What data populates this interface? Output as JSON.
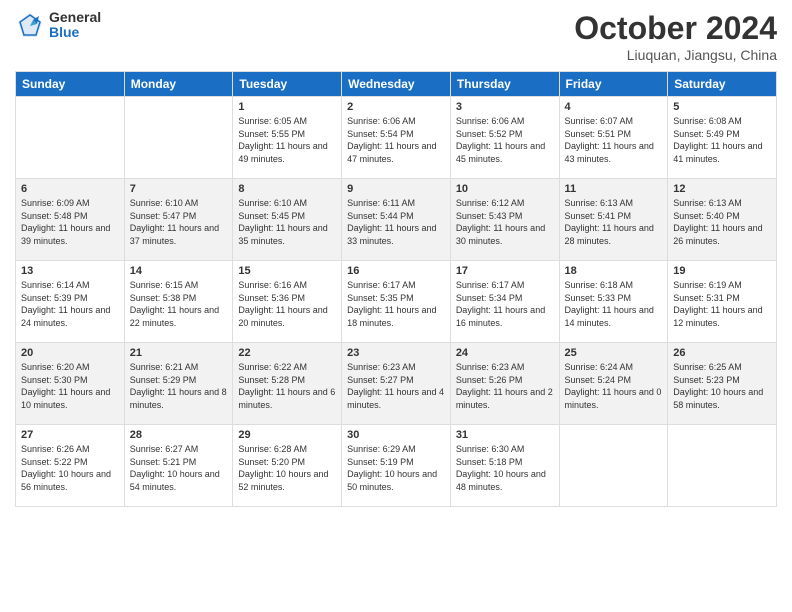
{
  "logo": {
    "general": "General",
    "blue": "Blue"
  },
  "header": {
    "month": "October 2024",
    "location": "Liuquan, Jiangsu, China"
  },
  "days_of_week": [
    "Sunday",
    "Monday",
    "Tuesday",
    "Wednesday",
    "Thursday",
    "Friday",
    "Saturday"
  ],
  "weeks": [
    [
      {
        "day": "",
        "info": ""
      },
      {
        "day": "",
        "info": ""
      },
      {
        "day": "1",
        "info": "Sunrise: 6:05 AM\nSunset: 5:55 PM\nDaylight: 11 hours and 49 minutes."
      },
      {
        "day": "2",
        "info": "Sunrise: 6:06 AM\nSunset: 5:54 PM\nDaylight: 11 hours and 47 minutes."
      },
      {
        "day": "3",
        "info": "Sunrise: 6:06 AM\nSunset: 5:52 PM\nDaylight: 11 hours and 45 minutes."
      },
      {
        "day": "4",
        "info": "Sunrise: 6:07 AM\nSunset: 5:51 PM\nDaylight: 11 hours and 43 minutes."
      },
      {
        "day": "5",
        "info": "Sunrise: 6:08 AM\nSunset: 5:49 PM\nDaylight: 11 hours and 41 minutes."
      }
    ],
    [
      {
        "day": "6",
        "info": "Sunrise: 6:09 AM\nSunset: 5:48 PM\nDaylight: 11 hours and 39 minutes."
      },
      {
        "day": "7",
        "info": "Sunrise: 6:10 AM\nSunset: 5:47 PM\nDaylight: 11 hours and 37 minutes."
      },
      {
        "day": "8",
        "info": "Sunrise: 6:10 AM\nSunset: 5:45 PM\nDaylight: 11 hours and 35 minutes."
      },
      {
        "day": "9",
        "info": "Sunrise: 6:11 AM\nSunset: 5:44 PM\nDaylight: 11 hours and 33 minutes."
      },
      {
        "day": "10",
        "info": "Sunrise: 6:12 AM\nSunset: 5:43 PM\nDaylight: 11 hours and 30 minutes."
      },
      {
        "day": "11",
        "info": "Sunrise: 6:13 AM\nSunset: 5:41 PM\nDaylight: 11 hours and 28 minutes."
      },
      {
        "day": "12",
        "info": "Sunrise: 6:13 AM\nSunset: 5:40 PM\nDaylight: 11 hours and 26 minutes."
      }
    ],
    [
      {
        "day": "13",
        "info": "Sunrise: 6:14 AM\nSunset: 5:39 PM\nDaylight: 11 hours and 24 minutes."
      },
      {
        "day": "14",
        "info": "Sunrise: 6:15 AM\nSunset: 5:38 PM\nDaylight: 11 hours and 22 minutes."
      },
      {
        "day": "15",
        "info": "Sunrise: 6:16 AM\nSunset: 5:36 PM\nDaylight: 11 hours and 20 minutes."
      },
      {
        "day": "16",
        "info": "Sunrise: 6:17 AM\nSunset: 5:35 PM\nDaylight: 11 hours and 18 minutes."
      },
      {
        "day": "17",
        "info": "Sunrise: 6:17 AM\nSunset: 5:34 PM\nDaylight: 11 hours and 16 minutes."
      },
      {
        "day": "18",
        "info": "Sunrise: 6:18 AM\nSunset: 5:33 PM\nDaylight: 11 hours and 14 minutes."
      },
      {
        "day": "19",
        "info": "Sunrise: 6:19 AM\nSunset: 5:31 PM\nDaylight: 11 hours and 12 minutes."
      }
    ],
    [
      {
        "day": "20",
        "info": "Sunrise: 6:20 AM\nSunset: 5:30 PM\nDaylight: 11 hours and 10 minutes."
      },
      {
        "day": "21",
        "info": "Sunrise: 6:21 AM\nSunset: 5:29 PM\nDaylight: 11 hours and 8 minutes."
      },
      {
        "day": "22",
        "info": "Sunrise: 6:22 AM\nSunset: 5:28 PM\nDaylight: 11 hours and 6 minutes."
      },
      {
        "day": "23",
        "info": "Sunrise: 6:23 AM\nSunset: 5:27 PM\nDaylight: 11 hours and 4 minutes."
      },
      {
        "day": "24",
        "info": "Sunrise: 6:23 AM\nSunset: 5:26 PM\nDaylight: 11 hours and 2 minutes."
      },
      {
        "day": "25",
        "info": "Sunrise: 6:24 AM\nSunset: 5:24 PM\nDaylight: 11 hours and 0 minutes."
      },
      {
        "day": "26",
        "info": "Sunrise: 6:25 AM\nSunset: 5:23 PM\nDaylight: 10 hours and 58 minutes."
      }
    ],
    [
      {
        "day": "27",
        "info": "Sunrise: 6:26 AM\nSunset: 5:22 PM\nDaylight: 10 hours and 56 minutes."
      },
      {
        "day": "28",
        "info": "Sunrise: 6:27 AM\nSunset: 5:21 PM\nDaylight: 10 hours and 54 minutes."
      },
      {
        "day": "29",
        "info": "Sunrise: 6:28 AM\nSunset: 5:20 PM\nDaylight: 10 hours and 52 minutes."
      },
      {
        "day": "30",
        "info": "Sunrise: 6:29 AM\nSunset: 5:19 PM\nDaylight: 10 hours and 50 minutes."
      },
      {
        "day": "31",
        "info": "Sunrise: 6:30 AM\nSunset: 5:18 PM\nDaylight: 10 hours and 48 minutes."
      },
      {
        "day": "",
        "info": ""
      },
      {
        "day": "",
        "info": ""
      }
    ]
  ]
}
